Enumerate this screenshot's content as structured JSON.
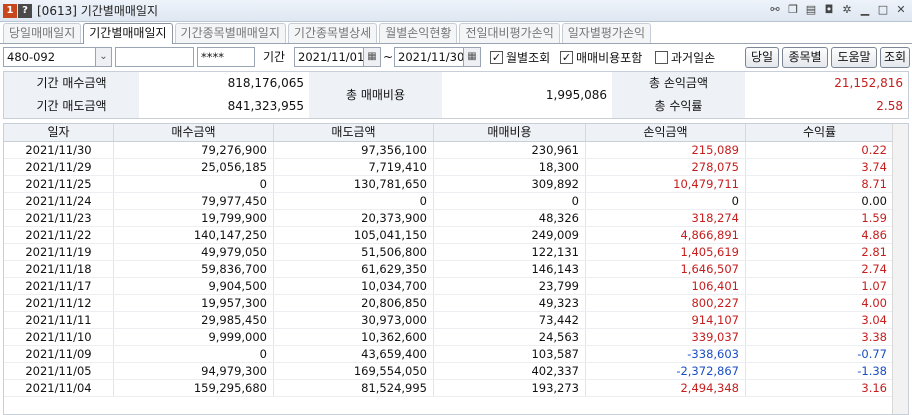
{
  "window": {
    "badge1": "1",
    "badge2": "?",
    "title": "[0613] 기간별매매일지"
  },
  "tabs": [
    "당일매매일지",
    "기간별매매일지",
    "기간종목별매매일지",
    "기간종목별상세",
    "월별손익현황",
    "전일대비평가손익",
    "일자별평가손익"
  ],
  "toolbar": {
    "account": "480-092",
    "password": "****",
    "period_label": "기간",
    "date_from": "2021/11/01",
    "tilde": "~",
    "date_to": "2021/11/30",
    "monthly": "월별조회",
    "include_fee": "매매비용포함",
    "past_loss": "과거일손",
    "btn_today": "당일",
    "btn_stock": "종목별",
    "btn_help": "도움말",
    "btn_query": "조회"
  },
  "summary": {
    "buy_label": "기간 매수금액",
    "buy_value": "818,176,065",
    "sell_label": "기간 매도금액",
    "sell_value": "841,323,955",
    "fee_label": "총 매매비용",
    "fee_value": "1,995,086",
    "pl_label": "총 손익금액",
    "pl_value": "21,152,816",
    "rate_label": "총 수익률",
    "rate_value": "2.58"
  },
  "table": {
    "headers": [
      "일자",
      "매수금액",
      "매도금액",
      "매매비용",
      "손익금액",
      "수익률"
    ],
    "rows": [
      [
        "2021/11/30",
        "79,276,900",
        "97,356,100",
        "230,961",
        "215,089",
        "0.22"
      ],
      [
        "2021/11/29",
        "25,056,185",
        "7,719,410",
        "18,300",
        "278,075",
        "3.74"
      ],
      [
        "2021/11/25",
        "0",
        "130,781,650",
        "309,892",
        "10,479,711",
        "8.71"
      ],
      [
        "2021/11/24",
        "79,977,450",
        "0",
        "0",
        "0",
        "0.00"
      ],
      [
        "2021/11/23",
        "19,799,900",
        "20,373,900",
        "48,326",
        "318,274",
        "1.59"
      ],
      [
        "2021/11/22",
        "140,147,250",
        "105,041,150",
        "249,009",
        "4,866,891",
        "4.86"
      ],
      [
        "2021/11/19",
        "49,979,050",
        "51,506,800",
        "122,131",
        "1,405,619",
        "2.81"
      ],
      [
        "2021/11/18",
        "59,836,700",
        "61,629,350",
        "146,143",
        "1,646,507",
        "2.74"
      ],
      [
        "2021/11/17",
        "9,904,500",
        "10,034,700",
        "23,799",
        "106,401",
        "1.07"
      ],
      [
        "2021/11/12",
        "19,957,300",
        "20,806,850",
        "49,323",
        "800,227",
        "4.00"
      ],
      [
        "2021/11/11",
        "29,985,450",
        "30,973,000",
        "73,442",
        "914,107",
        "3.04"
      ],
      [
        "2021/11/10",
        "9,999,000",
        "10,362,600",
        "24,563",
        "339,037",
        "3.38"
      ],
      [
        "2021/11/09",
        "0",
        "43,659,400",
        "103,587",
        "-338,603",
        "-0.77"
      ],
      [
        "2021/11/05",
        "94,979,300",
        "169,554,050",
        "402,337",
        "-2,372,867",
        "-1.38"
      ],
      [
        "2021/11/04",
        "159,295,680",
        "81,524,995",
        "193,273",
        "2,494,348",
        "3.16"
      ]
    ]
  },
  "colors": {
    "positive": "#c61d1d",
    "negative": "#1a4ec4"
  }
}
